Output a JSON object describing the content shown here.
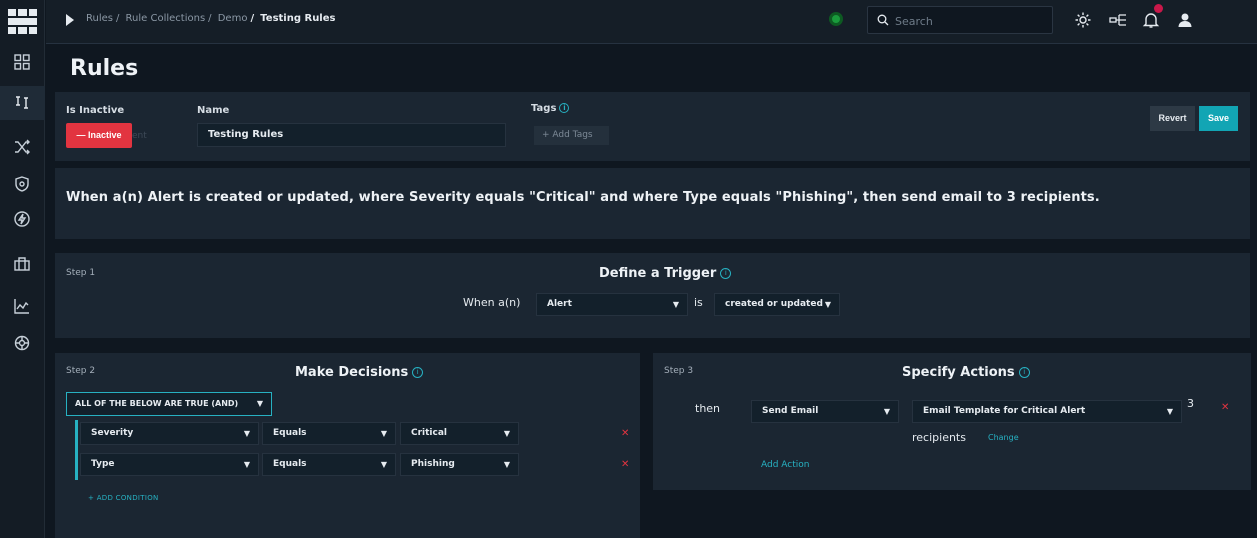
{
  "breadcrumb": {
    "items": [
      "Rules",
      "Rule Collections",
      "Demo"
    ],
    "current": "Testing Rules"
  },
  "search": {
    "placeholder": "Search"
  },
  "page": {
    "title": "Rules"
  },
  "header": {
    "status_label": "Is Inactive",
    "status_button": "— Inactive",
    "status_ghost": "ent",
    "name_label": "Name",
    "name_value": "Testing Rules",
    "tags_label": "Tags",
    "add_tags": "+ Add Tags",
    "revert": "Revert",
    "save": "Save"
  },
  "summary": "When a(n) Alert is created or updated, where Severity equals \"Critical\" and where Type equals \"Phishing\", then send email to 3 recipients.",
  "step1": {
    "step": "Step 1",
    "title": "Define a Trigger",
    "when": "When a(n)",
    "entity": "Alert",
    "is": "is",
    "event": "created or updated"
  },
  "step2": {
    "step": "Step 2",
    "title": "Make Decisions",
    "logic": "ALL OF THE BELOW ARE TRUE (AND)",
    "conditions": [
      {
        "field": "Severity",
        "operator": "Equals",
        "value": "Critical"
      },
      {
        "field": "Type",
        "operator": "Equals",
        "value": "Phishing"
      }
    ],
    "add_condition": "+ ADD CONDITION"
  },
  "step3": {
    "step": "Step 3",
    "title": "Specify Actions",
    "then": "then",
    "action": "Send Email",
    "template": "Email Template for Critical Alert",
    "recipient_count": "3",
    "recipients": "recipients",
    "change": "Change",
    "add_action": "Add Action"
  },
  "colors": {
    "accent": "#12a5b4",
    "danger": "#e23440",
    "status_ok": "#1a9b3c"
  }
}
